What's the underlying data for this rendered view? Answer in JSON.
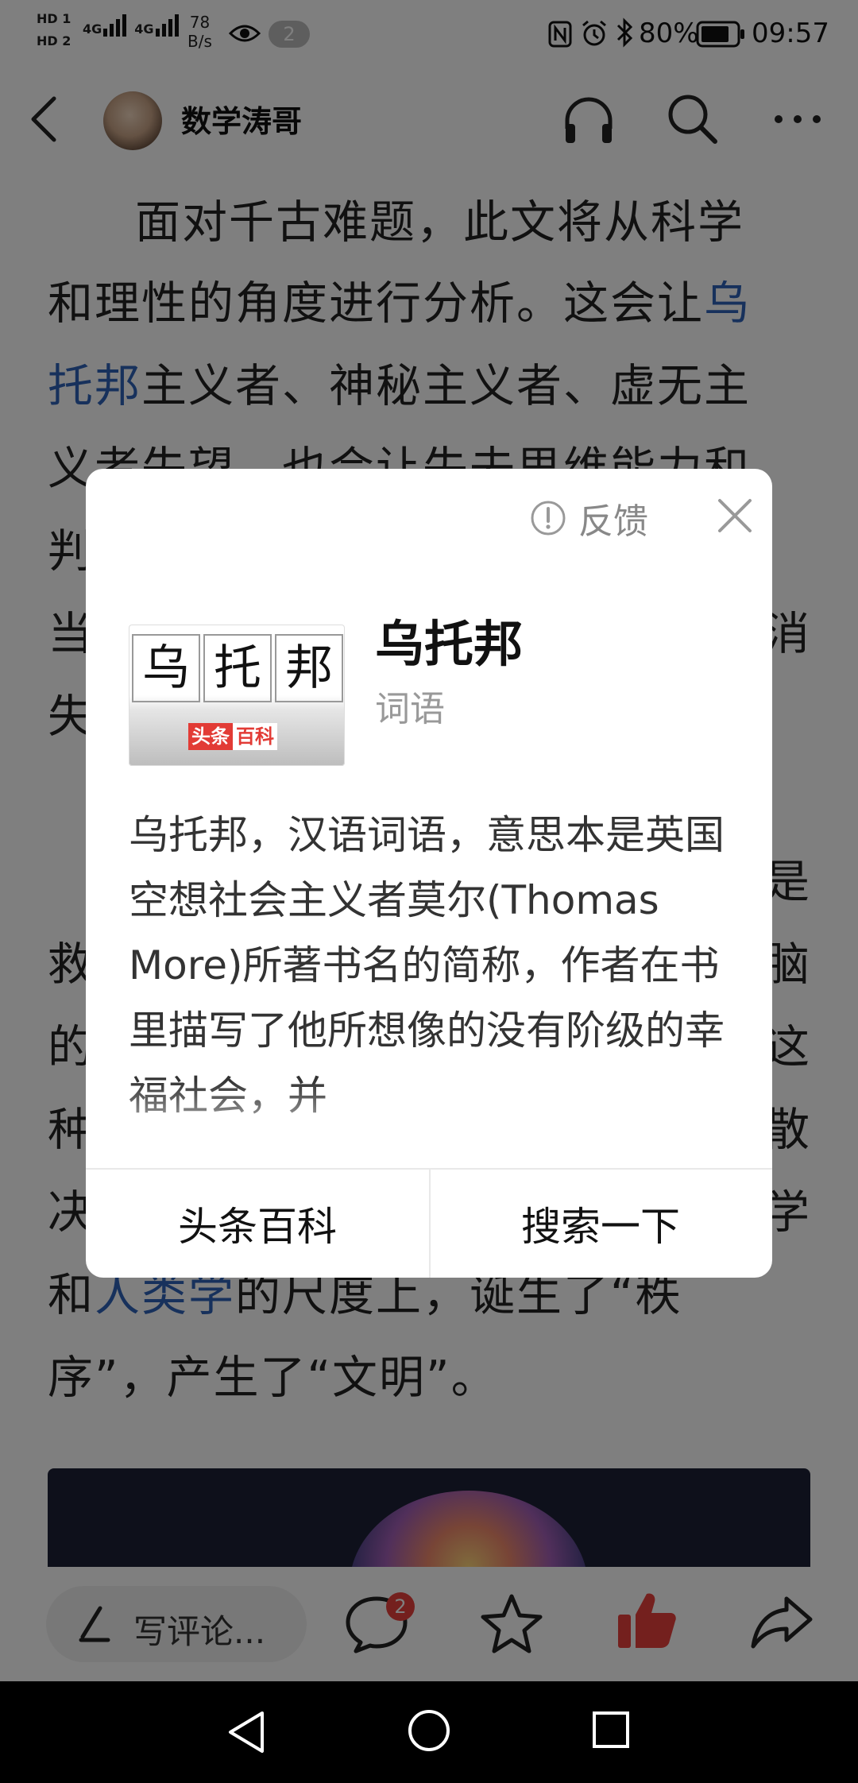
{
  "status_bar": {
    "hd1": "HD 1",
    "hd2": "HD 2",
    "net1": "4G",
    "net2": "4G",
    "speed_value": "78",
    "speed_unit": "B/s",
    "notif_count": "2",
    "battery": "80%",
    "time": "09:57"
  },
  "header": {
    "author": "数学涛哥"
  },
  "article": {
    "lines": [
      {
        "pre": "面对千古难题，此文将从科学",
        "link": "",
        "post": ""
      },
      {
        "pre": "和理性的角度进行分析。这会让",
        "link": "乌",
        "post": ""
      },
      {
        "pre": "",
        "link": "托邦",
        "post": "主义者、神秘主义者、虚无主"
      },
      {
        "pre": "义者失望，也会让失去思维能力和",
        "link": "",
        "post": ""
      },
      {
        "pre": "判",
        "link": "",
        "post": ""
      },
      {
        "pre": "当",
        "link": "",
        "post": ""
      },
      {
        "pre": "失",
        "link": "",
        "post": ""
      },
      {
        "pre": "救",
        "link": "",
        "post": ""
      },
      {
        "pre": "的",
        "link": "",
        "post": ""
      },
      {
        "pre": "种",
        "link": "",
        "post": ""
      },
      {
        "pre": "决",
        "link": "",
        "post": ""
      },
      {
        "pre": "和",
        "link": "人类学",
        "post": "的尺度上，诞生了“秩"
      },
      {
        "pre": "序”，产生了“文明”。",
        "link": "",
        "post": ""
      }
    ],
    "right_chars": [
      "消",
      "是",
      "脑",
      "这",
      "散",
      "学"
    ]
  },
  "dialog": {
    "feedback": "反馈",
    "thumb_chars": [
      "乌",
      "托",
      "邦"
    ],
    "logo_left": "头条",
    "logo_right": "百科",
    "title": "乌托邦",
    "type": "词语",
    "description": "乌托邦，汉语词语，意思本是英国空想社会主义者莫尔(Thomas More)所著书名的简称，作者在书里描写了他所想像的没有阶级的幸福社会，并",
    "btn_left": "头条百科",
    "btn_right": "搜索一下"
  },
  "toolbar": {
    "comment_placeholder": "写评论...",
    "comment_count": "2"
  },
  "colors": {
    "link": "#2e63b8",
    "like": "#e8413d",
    "logo_red": "#e23b35"
  }
}
